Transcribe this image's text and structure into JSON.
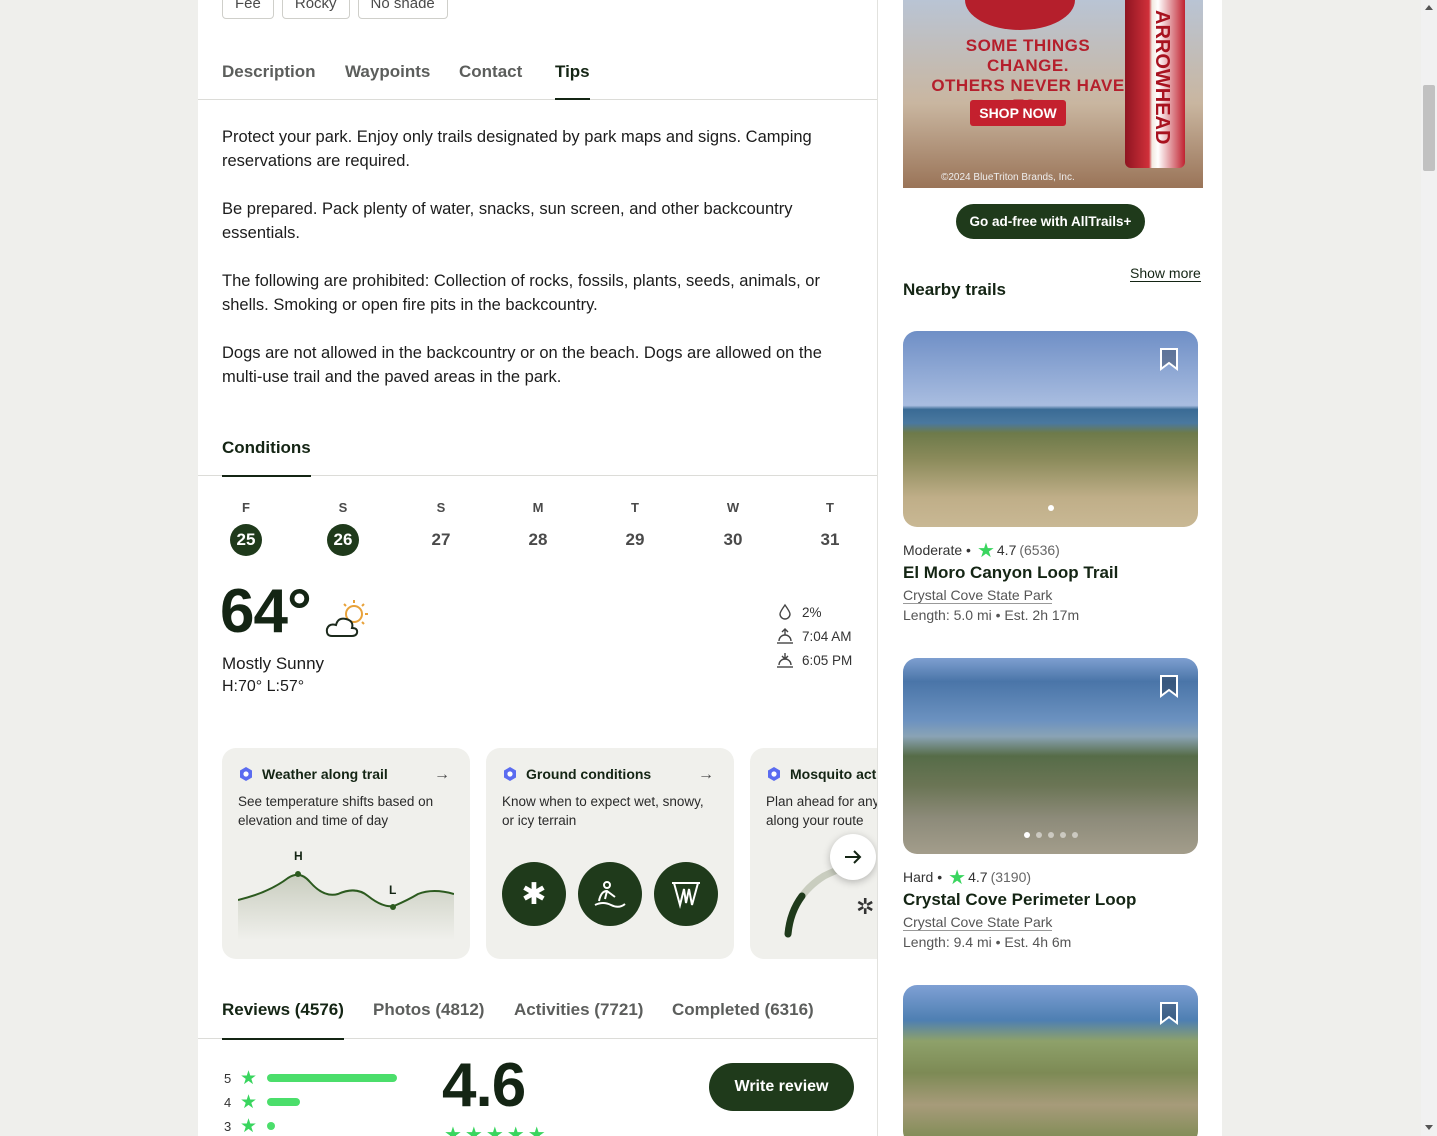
{
  "chips": [
    "Fee",
    "Rocky",
    "No shade"
  ],
  "tabs": [
    "Description",
    "Waypoints",
    "Contact",
    "Tips"
  ],
  "active_tab": "Tips",
  "tips": [
    "Protect your park. Enjoy only trails designated by park maps and signs. Camping reservations are required.",
    "Be prepared. Pack plenty of water, snacks, sun screen, and other backcountry essentials.",
    "The following are prohibited: Collection of rocks, fossils, plants, seeds, animals, or shells. Smoking or open fire pits in the backcountry.",
    "Dogs are not allowed in the backcountry or on the beach.  Dogs are allowed on the multi-use trail and the paved areas in the park."
  ],
  "conditions": {
    "title": "Conditions",
    "days": [
      {
        "letter": "F",
        "num": "25",
        "selected": true
      },
      {
        "letter": "S",
        "num": "26",
        "selected": true
      },
      {
        "letter": "S",
        "num": "27",
        "selected": false
      },
      {
        "letter": "M",
        "num": "28",
        "selected": false
      },
      {
        "letter": "T",
        "num": "29",
        "selected": false
      },
      {
        "letter": "W",
        "num": "30",
        "selected": false
      },
      {
        "letter": "T",
        "num": "31",
        "selected": false
      }
    ],
    "temp": "64°",
    "summary": "Mostly Sunny",
    "hilo": "H:70°  L:57°",
    "precip": "2%",
    "sunrise": "7:04 AM",
    "sunset": "6:05 PM",
    "weather_icon": "partly-sunny-icon"
  },
  "cards": [
    {
      "title": "Weather along trail",
      "desc": "See temperature shifts based on elevation and time of day",
      "high": "H",
      "low": "L"
    },
    {
      "title": "Ground conditions",
      "desc": "Know when to expect wet, snowy, or icy terrain"
    },
    {
      "title": "Mosquito activity",
      "desc": "Plan ahead for any mosquitoes along your route"
    }
  ],
  "review_tabs": [
    "Reviews (4576)",
    "Photos (4812)",
    "Activities (7721)",
    "Completed (6316)"
  ],
  "reviews": {
    "rating": "4.6",
    "rows": [
      {
        "n": "5",
        "fill": 1.0
      },
      {
        "n": "4",
        "fill": 0.25
      },
      {
        "n": "3",
        "fill": 0.06
      }
    ],
    "write_label": "Write review"
  },
  "ad": {
    "headline_1": "SOME THINGS CHANGE.",
    "headline_2": "OTHERS NEVER HAVE TO.",
    "cta": "SHOP NOW",
    "brand": "ARROWHEAD",
    "copyright": "©2024 BlueTriton Brands, Inc."
  },
  "adfree_label": "Go ad-free with AllTrails+",
  "nearby_title": "Nearby trails",
  "show_more": "Show more",
  "trails": [
    {
      "difficulty": "Moderate",
      "rating": "4.7",
      "count": "(6536)",
      "name": "El Moro Canyon Loop Trail",
      "park": "Crystal Cove State Park",
      "length": "Length: 5.0 mi",
      "est": "Est. 2h 17m"
    },
    {
      "difficulty": "Hard",
      "rating": "4.7",
      "count": "(3190)",
      "name": "Crystal Cove Perimeter Loop",
      "park": "Crystal Cove State Park",
      "length": "Length: 9.4 mi",
      "est": "Est. 4h 6m"
    }
  ],
  "colors": {
    "brand_dark": "#1f3a1b",
    "accent_green": "#39d55e"
  }
}
